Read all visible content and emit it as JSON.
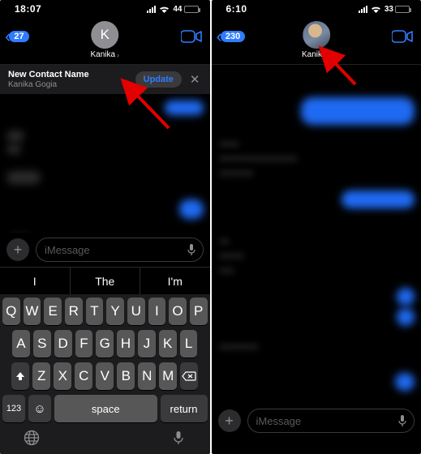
{
  "left": {
    "status": {
      "time": "18:07",
      "battery_pct": "44"
    },
    "back_count": "27",
    "avatar_initial": "K",
    "contact_name": "Kanika",
    "banner": {
      "title": "New Contact Name",
      "subtitle": "Kanika Gogia",
      "button": "Update"
    },
    "compose_placeholder": "iMessage",
    "suggestions": [
      "I",
      "The",
      "I'm"
    ],
    "keyboard": {
      "row1": [
        "Q",
        "W",
        "E",
        "R",
        "T",
        "Y",
        "U",
        "I",
        "O",
        "P"
      ],
      "row2": [
        "A",
        "S",
        "D",
        "F",
        "G",
        "H",
        "J",
        "K",
        "L"
      ],
      "row3": [
        "Z",
        "X",
        "C",
        "V",
        "B",
        "N",
        "M"
      ],
      "k123": "123",
      "space": "space",
      "return": "return"
    }
  },
  "right": {
    "status": {
      "time": "6:10",
      "battery_pct": "33"
    },
    "back_count": "230",
    "contact_name": "Kanika",
    "compose_placeholder": "iMessage"
  }
}
